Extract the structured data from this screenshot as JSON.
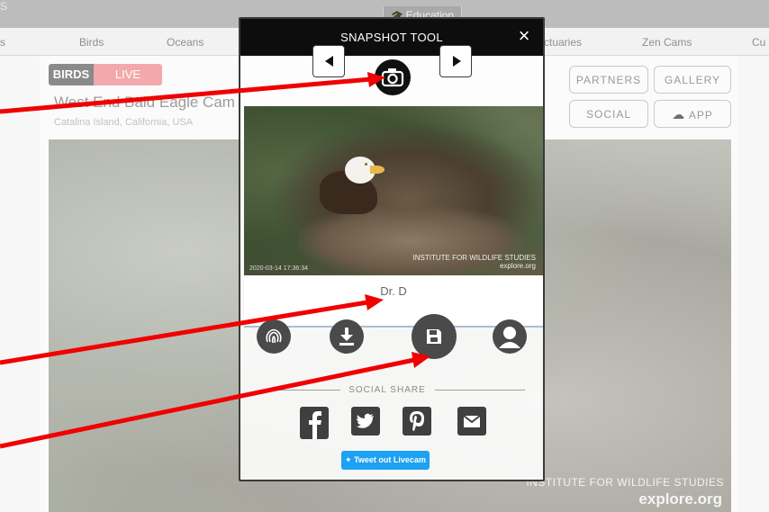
{
  "topbar": {
    "left_fragment": "S",
    "education_label": "Education"
  },
  "nav": {
    "items": [
      "s",
      "Birds",
      "Oceans",
      "ctuaries",
      "Zen Cams",
      "Cu"
    ]
  },
  "cam": {
    "tag_category": "BIRDS",
    "tag_live": "LIVE",
    "title": "West End Bald Eagle Cam",
    "location": "Catalina Island, California, USA"
  },
  "buttons": {
    "partners": "PARTNERS",
    "gallery": "GALLERY",
    "social": "SOCIAL",
    "app": "APP"
  },
  "video": {
    "watermark_line1": "INSTITUTE FOR WILDLIFE STUDIES",
    "watermark_line2": "explore.org"
  },
  "modal": {
    "title": "SNAPSHOT TOOL",
    "close_symbol": "×",
    "snapshot_timestamp": "2020-03-14 17:36:34",
    "snapshot_watermark_line1": "INSTITUTE FOR WILDLIFE STUDIES",
    "snapshot_watermark_line2": "explore.org",
    "caption_user": "Dr. D",
    "social_share_label": "SOCIAL SHARE",
    "tweet_label": "Tweet out Livecam"
  },
  "colors": {
    "live_tag": "#f3a9ab",
    "tweet_button": "#1da1f2",
    "annotation_arrow": "#f00000"
  }
}
